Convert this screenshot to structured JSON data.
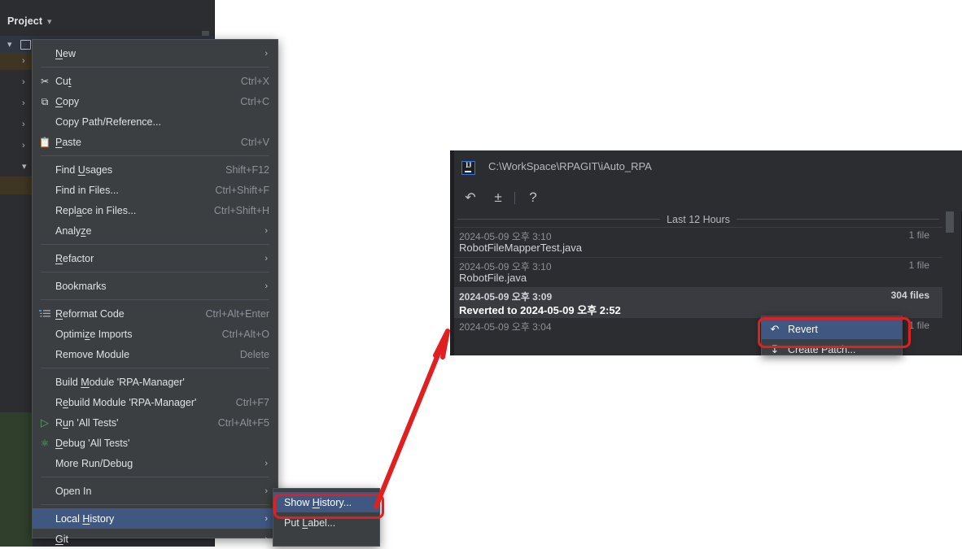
{
  "ide": {
    "tool_window_title": "Project",
    "tool_window_chevron": "chevron-down",
    "tree_rows": [
      {
        "chevron": "⌄",
        "indent": 10,
        "state": "expanded",
        "highlight": "blue"
      },
      {
        "chevron": "›",
        "indent": 27,
        "state": "collapsed",
        "highlight": "brown"
      },
      {
        "chevron": "›",
        "indent": 27,
        "state": "collapsed",
        "highlight": "none"
      },
      {
        "chevron": "›",
        "indent": 27,
        "state": "collapsed",
        "highlight": "none"
      },
      {
        "chevron": "›",
        "indent": 27,
        "state": "collapsed",
        "highlight": "none"
      },
      {
        "chevron": "›",
        "indent": 27,
        "state": "collapsed",
        "highlight": "none"
      },
      {
        "chevron": "⌄",
        "indent": 27,
        "state": "expanded",
        "highlight": "none"
      },
      {
        "chevron": "",
        "indent": 27,
        "state": "leaf",
        "highlight": "brown"
      }
    ]
  },
  "context_menu": {
    "items": [
      {
        "label": "New",
        "mnemonic": "N",
        "shortcut": "",
        "icon": "",
        "submenu": true,
        "selected": false
      },
      {
        "type": "separator"
      },
      {
        "label": "Cut",
        "mnemonic": "t",
        "shortcut": "Ctrl+X",
        "icon": "scissors-icon",
        "glyph": "✂",
        "submenu": false,
        "selected": false
      },
      {
        "label": "Copy",
        "mnemonic": "C",
        "shortcut": "Ctrl+C",
        "icon": "copy-icon",
        "glyph": "⧉",
        "submenu": false,
        "selected": false
      },
      {
        "label": "Copy Path/Reference...",
        "mnemonic": "",
        "shortcut": "",
        "icon": "",
        "submenu": false,
        "selected": false
      },
      {
        "label": "Paste",
        "mnemonic": "P",
        "shortcut": "Ctrl+V",
        "icon": "clipboard-icon",
        "glyph": "ὌB",
        "submenu": false,
        "selected": false
      },
      {
        "type": "separator"
      },
      {
        "label": "Find Usages",
        "mnemonic": "U",
        "shortcut": "Shift+F12",
        "icon": "",
        "submenu": false,
        "selected": false
      },
      {
        "label": "Find in Files...",
        "mnemonic": "",
        "shortcut": "Ctrl+Shift+F",
        "icon": "",
        "submenu": false,
        "selected": false
      },
      {
        "label": "Replace in Files...",
        "mnemonic": "a",
        "shortcut": "Ctrl+Shift+H",
        "icon": "",
        "submenu": false,
        "selected": false
      },
      {
        "label": "Analyze",
        "mnemonic": "z",
        "shortcut": "",
        "icon": "",
        "submenu": true,
        "selected": false
      },
      {
        "type": "separator"
      },
      {
        "label": "Refactor",
        "mnemonic": "R",
        "shortcut": "",
        "icon": "",
        "submenu": true,
        "selected": false
      },
      {
        "type": "separator"
      },
      {
        "label": "Bookmarks",
        "mnemonic": "",
        "shortcut": "",
        "icon": "",
        "submenu": true,
        "selected": false
      },
      {
        "type": "separator"
      },
      {
        "label": "Reformat Code",
        "mnemonic": "R",
        "shortcut": "Ctrl+Alt+Enter",
        "icon": "reformat-icon",
        "submenu": false,
        "selected": false
      },
      {
        "label": "Optimize Imports",
        "mnemonic": "z",
        "shortcut": "Ctrl+Alt+O",
        "icon": "",
        "submenu": false,
        "selected": false
      },
      {
        "label": "Remove Module",
        "mnemonic": "",
        "shortcut": "Delete",
        "icon": "",
        "submenu": false,
        "selected": false
      },
      {
        "type": "separator"
      },
      {
        "label": "Build Module 'RPA-Manager'",
        "mnemonic": "M",
        "shortcut": "",
        "icon": "",
        "submenu": false,
        "selected": false
      },
      {
        "label": "Rebuild Module 'RPA-Manager'",
        "mnemonic": "e",
        "shortcut": "Ctrl+F7",
        "icon": "",
        "submenu": false,
        "selected": false
      },
      {
        "label": "Run 'All Tests'",
        "mnemonic": "u",
        "shortcut": "Ctrl+Alt+F5",
        "icon": "run-icon",
        "glyph": "▷",
        "submenu": false,
        "selected": false
      },
      {
        "label": "Debug 'All Tests'",
        "mnemonic": "D",
        "shortcut": "",
        "icon": "debug-icon",
        "glyph": "⚙",
        "submenu": false,
        "selected": false
      },
      {
        "label": "More Run/Debug",
        "mnemonic": "",
        "shortcut": "",
        "icon": "",
        "submenu": true,
        "selected": false
      },
      {
        "type": "separator"
      },
      {
        "label": "Open In",
        "mnemonic": "",
        "shortcut": "",
        "icon": "",
        "submenu": true,
        "selected": false
      },
      {
        "type": "separator"
      },
      {
        "label": "Local History",
        "mnemonic": "H",
        "shortcut": "",
        "icon": "",
        "submenu": true,
        "selected": true
      },
      {
        "label": "Git",
        "mnemonic": "G",
        "shortcut": "",
        "icon": "",
        "submenu": true,
        "selected": false
      }
    ]
  },
  "submenu": {
    "items": [
      {
        "label": "Show History...",
        "mnemonic": "H",
        "selected": true
      },
      {
        "label": "Put Label...",
        "mnemonic": "L",
        "selected": false
      }
    ]
  },
  "local_history_dialog": {
    "app_icon": "intellij-idea-icon",
    "app_icon_text": "IJ",
    "title": "C:\\WorkSpace\\RPAGIT\\iAuto_RPA",
    "toolbar": [
      {
        "name": "revert-icon",
        "glyph": "↶"
      },
      {
        "name": "show-diff-icon",
        "glyph": "±"
      },
      {
        "name": "help-icon",
        "glyph": "?"
      }
    ],
    "group_label": "Last 12 Hours",
    "revisions": [
      {
        "timestamp": "2024-05-09 오후 3:10",
        "name": "RobotFileMapperTest.java",
        "files": "1 file",
        "selected": false
      },
      {
        "timestamp": "2024-05-09 오후 3:10",
        "name": "RobotFile.java",
        "files": "1 file",
        "selected": false
      },
      {
        "timestamp": "2024-05-09 오후 3:09",
        "name": "Reverted to 2024-05-09 오후 2:52",
        "files": "304 files",
        "selected": true
      },
      {
        "timestamp": "2024-05-09 오후 3:04",
        "name": "",
        "files": "1 file",
        "selected": false
      }
    ]
  },
  "revert_popup": {
    "items": [
      {
        "label": "Revert",
        "icon": "revert-arrow-icon",
        "glyph": "↶",
        "selected": true
      },
      {
        "label": "Create Patch...",
        "icon": "create-patch-icon",
        "glyph": "⤓",
        "selected": false
      }
    ]
  },
  "annotations": {
    "highlight_color": "#e02020",
    "boxes": [
      "show-history-highlight",
      "revert-highlight"
    ],
    "arrow": "arrow-from-show-history-to-revert"
  }
}
